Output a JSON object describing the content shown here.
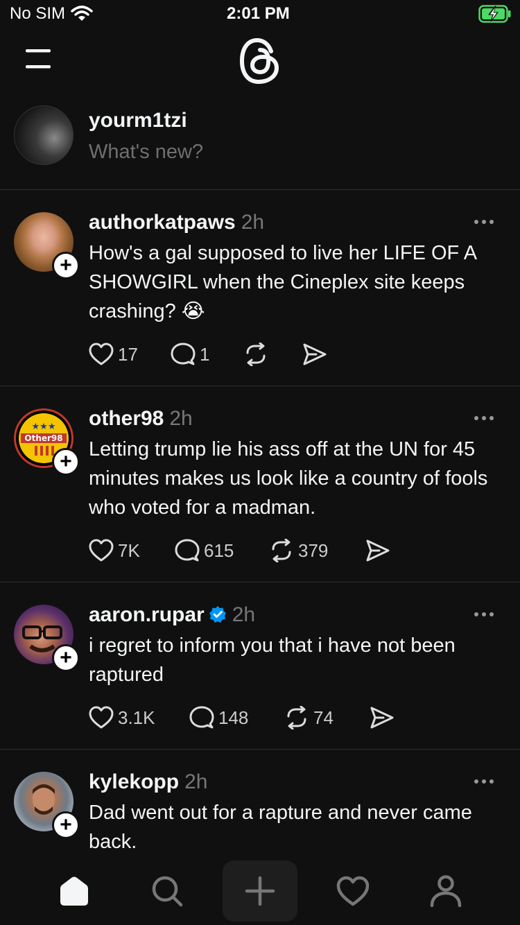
{
  "status_bar": {
    "carrier": "No SIM",
    "time": "2:01 PM"
  },
  "composer": {
    "username": "yourm1tzi",
    "placeholder": "What's new?"
  },
  "posts": [
    {
      "username": "authorkatpaws",
      "time": "2h",
      "text": "How's a gal supposed to live her LIFE OF A SHOWGIRL when the Cineplex site keeps crashing? 😭",
      "likes": "17",
      "replies": "1",
      "reposts": "",
      "verified": false
    },
    {
      "username": "other98",
      "time": "2h",
      "text": "Letting trump lie his ass off at the UN for 45 minutes makes us look like a country of fools who voted for a madman.",
      "likes": "7K",
      "replies": "615",
      "reposts": "379",
      "verified": false
    },
    {
      "username": "aaron.rupar",
      "time": "2h",
      "text": "i regret to inform you that i have not been raptured",
      "likes": "3.1K",
      "replies": "148",
      "reposts": "74",
      "verified": true
    },
    {
      "username": "kylekopp",
      "time": "2h",
      "text": "Dad went out for a rapture and never came back.",
      "verified": false
    }
  ],
  "avatar_badges": {
    "other98": "Other98"
  },
  "icons": {
    "menu": "menu-icon",
    "logo": "threads-logo-icon",
    "like": "heart-icon",
    "reply": "comment-icon",
    "repost": "repost-icon",
    "share": "send-icon",
    "more": "more-dots-icon",
    "home": "home-icon",
    "search": "search-icon",
    "create": "plus-icon",
    "activity": "heart-icon",
    "profile": "profile-icon"
  },
  "colors": {
    "background": "#101010",
    "text": "#f3f5f7",
    "secondary": "#777777",
    "verified": "#0095f6",
    "battery": "#4cd964"
  }
}
